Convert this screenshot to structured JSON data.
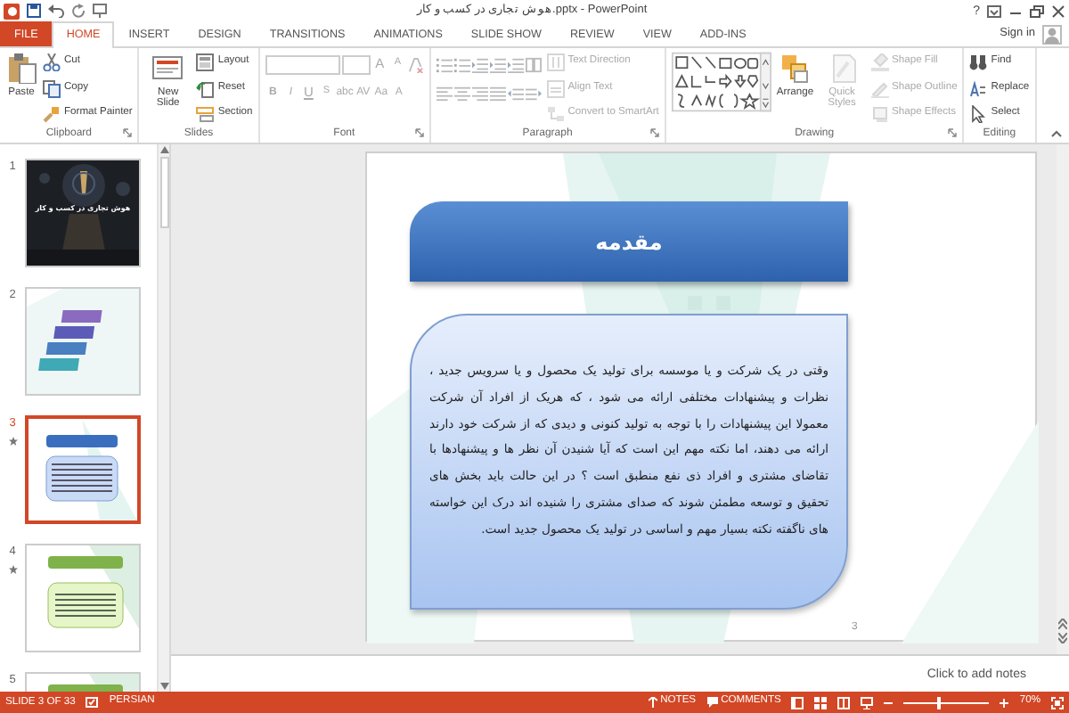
{
  "title_bar": {
    "title": "هوش تجاری در کسب و کار.pptx - PowerPoint",
    "help": "?"
  },
  "tabs": [
    {
      "label": "FILE",
      "kind": "file",
      "selected": false
    },
    {
      "label": "HOME",
      "kind": "tab",
      "selected": true
    },
    {
      "label": "INSERT",
      "kind": "tab",
      "selected": false
    },
    {
      "label": "DESIGN",
      "kind": "tab",
      "selected": false
    },
    {
      "label": "TRANSITIONS",
      "kind": "tab",
      "selected": false
    },
    {
      "label": "ANIMATIONS",
      "kind": "tab",
      "selected": false
    },
    {
      "label": "SLIDE SHOW",
      "kind": "tab",
      "selected": false
    },
    {
      "label": "REVIEW",
      "kind": "tab",
      "selected": false
    },
    {
      "label": "VIEW",
      "kind": "tab",
      "selected": false
    },
    {
      "label": "ADD-INS",
      "kind": "tab",
      "selected": false
    }
  ],
  "account": {
    "label": "Sign in"
  },
  "ribbon": [
    {
      "label": "Clipboard",
      "launcher": true,
      "columns": [
        [
          {
            "kind": "large",
            "label": "Paste",
            "disabled": false
          }
        ],
        [
          {
            "kind": "small",
            "label": "Cut",
            "disabled": false
          },
          {
            "kind": "small",
            "label": "Copy",
            "disabled": false
          },
          {
            "kind": "small",
            "label": "Format Painter",
            "disabled": false
          }
        ]
      ]
    },
    {
      "label": "Slides",
      "launcher": false,
      "columns": [
        [
          {
            "kind": "large",
            "label": "New Slide",
            "disabled": false
          }
        ],
        [
          {
            "kind": "small",
            "label": "Layout",
            "disabled": false
          },
          {
            "kind": "small",
            "label": "Reset",
            "disabled": false
          },
          {
            "kind": "small",
            "label": "Section",
            "disabled": false
          }
        ]
      ]
    },
    {
      "label": "Font",
      "launcher": true,
      "columns": [
        [
          {
            "kind": "row",
            "items": [
              {
                "kind": "fontname"
              },
              {
                "kind": "fontsize"
              },
              {
                "kind": "glyph",
                "label": "A",
                "disabled": true
              },
              {
                "kind": "glyph",
                "label": "A",
                "disabled": true
              },
              {
                "kind": "icon"
              }
            ]
          },
          {
            "kind": "row",
            "items": [
              {
                "kind": "glyph",
                "label": "B",
                "disabled": true
              },
              {
                "kind": "glyph",
                "label": "I",
                "disabled": true
              },
              {
                "kind": "glyph",
                "label": "U",
                "disabled": true
              },
              {
                "kind": "glyph",
                "label": "S",
                "disabled": true
              },
              {
                "kind": "glyph",
                "label": "abc",
                "disabled": true
              },
              {
                "kind": "glyph",
                "label": "AV",
                "disabled": true
              },
              {
                "kind": "glyph",
                "label": "Aa",
                "disabled": true
              },
              {
                "kind": "glyph",
                "label": "A",
                "disabled": true
              }
            ]
          }
        ]
      ]
    },
    {
      "label": "Paragraph",
      "launcher": true,
      "columns": [
        [
          {
            "kind": "row",
            "items": [
              {
                "kind": "icon"
              },
              {
                "kind": "icon"
              },
              {
                "kind": "icon"
              },
              {
                "kind": "icon"
              },
              {
                "kind": "icon"
              },
              {
                "kind": "icon"
              }
            ]
          },
          {
            "kind": "row",
            "items": [
              {
                "kind": "icon"
              },
              {
                "kind": "icon"
              },
              {
                "kind": "icon"
              },
              {
                "kind": "icon"
              },
              {
                "kind": "icon"
              },
              {
                "kind": "icon"
              }
            ]
          }
        ],
        [
          {
            "kind": "small",
            "label": "Text Direction",
            "disabled": true
          },
          {
            "kind": "small",
            "label": "Align Text",
            "disabled": true
          },
          {
            "kind": "small",
            "label": "Convert to SmartArt",
            "disabled": true
          }
        ]
      ]
    },
    {
      "label": "Drawing",
      "launcher": true,
      "columns": [
        [
          {
            "kind": "gallery"
          }
        ],
        [
          {
            "kind": "large",
            "label": "Arrange",
            "disabled": false
          }
        ],
        [
          {
            "kind": "large",
            "label": "Quick Styles",
            "disabled": true
          }
        ],
        [
          {
            "kind": "small",
            "label": "Shape Fill",
            "disabled": true
          },
          {
            "kind": "small",
            "label": "Shape Outline",
            "disabled": true
          },
          {
            "kind": "small",
            "label": "Shape Effects",
            "disabled": true
          }
        ]
      ]
    },
    {
      "label": "Editing",
      "launcher": false,
      "columns": [
        [
          {
            "kind": "small",
            "label": "Find",
            "disabled": false
          },
          {
            "kind": "small",
            "label": "Replace",
            "disabled": false
          },
          {
            "kind": "small",
            "label": "Select",
            "disabled": false
          }
        ]
      ]
    }
  ],
  "slides": [
    {
      "number": "1",
      "kind": "title",
      "text": "هوش تجاری در کسب و کار",
      "animated": false,
      "selected": false
    },
    {
      "number": "2",
      "kind": "steps",
      "animated": false,
      "selected": false
    },
    {
      "number": "3",
      "kind": "blue",
      "animated": true,
      "selected": true
    },
    {
      "number": "4",
      "kind": "green",
      "animated": true,
      "selected": false
    },
    {
      "number": "5",
      "kind": "green",
      "animated": false,
      "selected": false
    }
  ],
  "slide": {
    "title": "مقدمه",
    "body": "وقتی در یک شرکت و یا موسسه برای تولید یک محصول و یا سرویس جدید ، نظرات و پیشنهادات مختلفی ارائه می شود ، که هریک از افراد آن شرکت معمولا این پیشنهادات را با توجه به تولید کنونی و دیدی که از شرکت خود دارند ارائه می دهند، اما نکته مهم این است که آیا شنیدن آن نظر ها و پیشنهادها با تقاضای مشتری و افراد ذی نفع منطبق است ؟ در این حالت باید بخش های تحقیق و توسعه مطمئن شوند که صدای مشتری را شنیده اند درک این خواسته های ناگفته نکته بسیار مهم و اساسی در تولید یک محصول جدید است.",
    "number": "3"
  },
  "notes": {
    "placeholder": "Click to add notes"
  },
  "status_bar": {
    "slide_info": "SLIDE 3 OF 33",
    "language": "PERSIAN",
    "notes": "NOTES",
    "comments": "COMMENTS",
    "zoom": {
      "level": 0.38
    },
    "zoom_text": "70%"
  }
}
